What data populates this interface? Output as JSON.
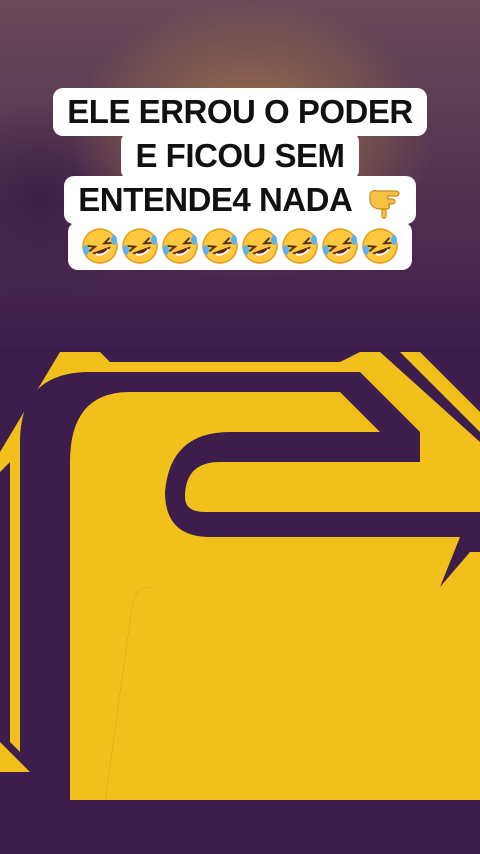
{
  "caption": {
    "line1": "ELE ERROU O PODER",
    "line2": "E FICOU SEM",
    "line3": "ENTENDE4 NADA",
    "pointing_emoji": "backhand-index-pointing-down",
    "laughing_emoji": "rolling-on-the-floor-laughing",
    "laughing_count": 8
  },
  "colors": {
    "brand_yellow": "#f2c01a",
    "brand_purple": "#3d1d4c"
  },
  "video": {
    "logo": "F"
  }
}
